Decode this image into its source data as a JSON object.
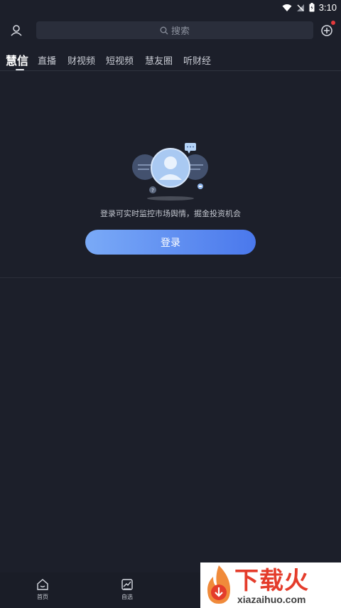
{
  "status_bar": {
    "time": "3:10",
    "icons": [
      "wifi-icon",
      "no-signal-icon",
      "battery-icon"
    ]
  },
  "top_bar": {
    "user_icon": "user-icon",
    "search_icon": "search-icon",
    "search_placeholder": "搜索",
    "add_icon": "add-circle-icon",
    "notification_color": "#e4393c"
  },
  "tabs": [
    {
      "label": "慧信",
      "active": true
    },
    {
      "label": "直播"
    },
    {
      "label": "财视频"
    },
    {
      "label": "短视频"
    },
    {
      "label": "慧友圈"
    },
    {
      "label": "听财经"
    }
  ],
  "empty_state": {
    "message": "登录可实时监控市场舆情，掘金投资机会",
    "login_label": "登录"
  },
  "bottom_nav": [
    {
      "label": "首页",
      "icon": "home-icon"
    },
    {
      "label": "自选",
      "icon": "chart-icon"
    }
  ],
  "watermark": {
    "brand": "下载火",
    "domain": "xiazaihuo.com"
  },
  "colors": {
    "background": "#1c1f2a",
    "accent_start": "#7aaaf7",
    "accent_end": "#4a78ec",
    "watermark": "#e43c2b"
  }
}
